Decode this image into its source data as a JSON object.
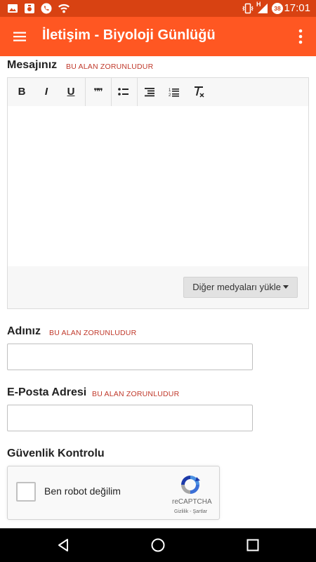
{
  "status_bar": {
    "time": "17:01",
    "left_icons": [
      "image-icon",
      "notification-icon",
      "phone-icon",
      "wifi-icon"
    ],
    "right_icons": [
      "vibrate-icon",
      "signal-icon",
      "battery-icon"
    ],
    "network_label": "H",
    "battery_level": "38"
  },
  "app_bar": {
    "title": "İletişim - Biyoloji Günlüğü",
    "background": "#ff5722",
    "status_background": "#d84212"
  },
  "form": {
    "required_text": "BU ALAN ZORUNLUDUR",
    "required_color": "#c0392b",
    "message_label": "Mesajınız",
    "toolbar_buttons": [
      "bold-icon",
      "italic-icon",
      "underline-icon",
      "quote-icon",
      "bulleted-list-icon",
      "indent-icon",
      "numbered-list-icon",
      "clear-format-icon"
    ],
    "toolbar_glyphs": {
      "bold": "B",
      "italic": "I",
      "underline": "U",
      "quote": "❞❞"
    },
    "message_value": "",
    "media_button_label": "Diğer medyaları yükle",
    "name_label": "Adınız",
    "name_value": "",
    "email_label": "E-Posta Adresi",
    "email_value": "",
    "security_label": "Güvenlik Kontrolu",
    "recaptcha": {
      "checkbox_label": "Ben robot değilim",
      "brand": "reCAPTCHA",
      "links": "Gizlilik - Şartlar",
      "checked": false
    }
  },
  "nav_bar": {
    "buttons": [
      "back-icon",
      "home-icon",
      "recents-icon"
    ]
  }
}
